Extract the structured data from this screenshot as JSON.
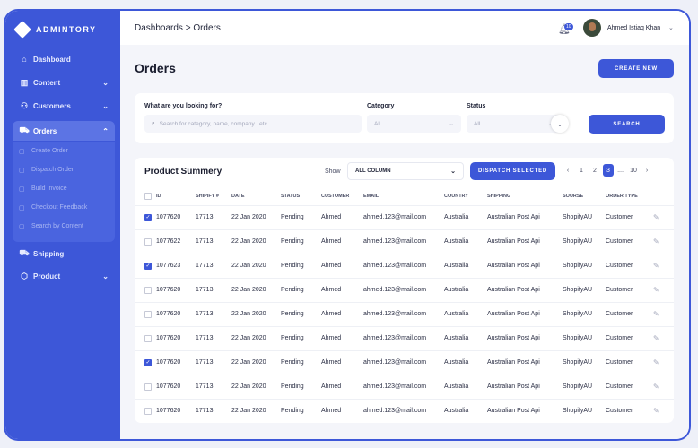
{
  "brand": {
    "name": "ADMINTORY",
    "logo_icon": "diamond-logo-icon"
  },
  "sidebar": {
    "items": [
      {
        "label": "Dashboard",
        "icon": "home-icon",
        "expandable": false
      },
      {
        "label": "Content",
        "icon": "chart-icon",
        "expandable": true
      },
      {
        "label": "Customers",
        "icon": "users-icon",
        "expandable": true
      },
      {
        "label": "Orders",
        "icon": "cart-icon",
        "expandable": true,
        "active": true
      },
      {
        "label": "Shipping",
        "icon": "truck-icon",
        "expandable": false
      },
      {
        "label": "Product",
        "icon": "box-icon",
        "expandable": true
      }
    ],
    "orders_submenu": [
      "Create Order",
      "Dispatch Order",
      "Build Invoice",
      "Checkout Feedback",
      "Search by Content"
    ]
  },
  "topbar": {
    "breadcrumb": "Dashboards > Orders",
    "notification_count": "10",
    "user_name": "Ahmed Istiaq Khan"
  },
  "page": {
    "title": "Orders",
    "create_button": "CREATE NEW"
  },
  "search": {
    "query_label": "What are you looking for?",
    "query_placeholder": "Search for category, name, company , etc",
    "category_label": "Category",
    "category_value": "All",
    "status_label": "Status",
    "status_value": "All",
    "search_button": "SEARCH"
  },
  "table": {
    "title": "Product Summery",
    "show_label": "Show",
    "column_select": "ALL COLUMN",
    "dispatch_button": "DISPATCH SELECTED",
    "pagination": {
      "pages": [
        "1",
        "2",
        "3"
      ],
      "current": "3",
      "ellipsis": "....",
      "last": "10"
    },
    "headers": [
      "ID",
      "SHIPIFY #",
      "DATE",
      "STATUS",
      "CUSTOMER",
      "EMAIL",
      "COUNTRY",
      "SHIPPING",
      "SOURSE",
      "ORDER TYPE"
    ],
    "rows": [
      {
        "checked": true,
        "cells": [
          "1077620",
          "17713",
          "22 Jan 2020",
          "Pending",
          "Ahmed",
          "ahmed.123@mail.com",
          "Australia",
          "Australian Post Api",
          "ShopifyAU",
          "Customer"
        ]
      },
      {
        "checked": false,
        "cells": [
          "1077622",
          "17713",
          "22 Jan 2020",
          "Pending",
          "Ahmed",
          "ahmed.123@mail.com",
          "Australia",
          "Australian Post Api",
          "ShopifyAU",
          "Customer"
        ]
      },
      {
        "checked": true,
        "cells": [
          "1077623",
          "17713",
          "22 Jan 2020",
          "Pending",
          "Ahmed",
          "ahmed.123@mail.com",
          "Australia",
          "Australian Post Api",
          "ShopifyAU",
          "Customer"
        ]
      },
      {
        "checked": false,
        "cells": [
          "1077620",
          "17713",
          "22 Jan 2020",
          "Pending",
          "Ahmed",
          "ahmed.123@mail.com",
          "Australia",
          "Australian Post Api",
          "ShopifyAU",
          "Customer"
        ]
      },
      {
        "checked": false,
        "cells": [
          "1077620",
          "17713",
          "22 Jan 2020",
          "Pending",
          "Ahmed",
          "ahmed.123@mail.com",
          "Australia",
          "Australian Post Api",
          "ShopifyAU",
          "Customer"
        ]
      },
      {
        "checked": false,
        "cells": [
          "1077620",
          "17713",
          "22 Jan 2020",
          "Pending",
          "Ahmed",
          "ahmed.123@mail.com",
          "Australia",
          "Australian Post Api",
          "ShopifyAU",
          "Customer"
        ]
      },
      {
        "checked": true,
        "cells": [
          "1077620",
          "17713",
          "22 Jan 2020",
          "Pending",
          "Ahmed",
          "ahmed.123@mail.com",
          "Australia",
          "Australian Post Api",
          "ShopifyAU",
          "Customer"
        ]
      },
      {
        "checked": false,
        "cells": [
          "1077620",
          "17713",
          "22 Jan 2020",
          "Pending",
          "Ahmed",
          "ahmed.123@mail.com",
          "Australia",
          "Australian Post Api",
          "ShopifyAU",
          "Customer"
        ]
      },
      {
        "checked": false,
        "cells": [
          "1077620",
          "17713",
          "22 Jan 2020",
          "Pending",
          "Ahmed",
          "ahmed.123@mail.com",
          "Australia",
          "Australian Post Api",
          "ShopifyAU",
          "Customer"
        ]
      }
    ]
  },
  "colors": {
    "accent": "#3d57d8",
    "sidebar_active": "#5c74e4",
    "page_bg": "#f4f5fa"
  }
}
